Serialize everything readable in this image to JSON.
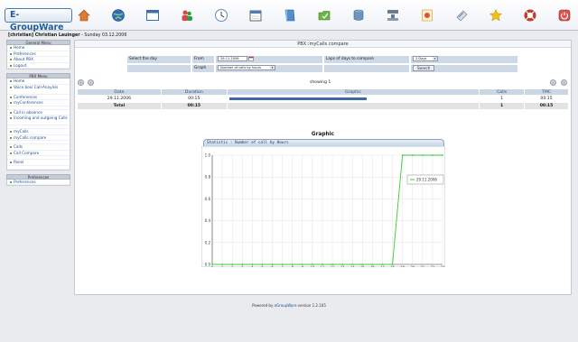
{
  "app": {
    "logo": "E-GroupWare",
    "toolbar_icons": [
      "home-icon",
      "globe-icon",
      "window-icon",
      "users-icon",
      "clock-icon",
      "calendar-icon",
      "book-icon",
      "file-manager-icon",
      "database-icon",
      "network-icon",
      "notes-icon",
      "printer-icon",
      "star-icon",
      "help-icon",
      "logout-icon"
    ]
  },
  "user": {
    "name": "[christian] Christian Lauinger",
    "date": " - Sunday 03.12.2006"
  },
  "sidebar": {
    "general_title": "General Menu",
    "general_items": [
      "Home",
      "Preferences",
      "About PBX",
      "Logout"
    ],
    "pbx_title": "PBX Menu",
    "pbx_groups": [
      [
        "Home",
        "Voice box/ Call-Anaylsis",
        "Conferences",
        "myConferences"
      ],
      [
        "Call in absence",
        "Incoming and outgoing Calls"
      ],
      [
        "myCalls",
        "myCalls compare"
      ],
      [
        "Calls",
        "Call Compare"
      ],
      [
        "Panel"
      ]
    ],
    "prefs_title": "Preferences",
    "prefs_items": [
      "Preferences"
    ]
  },
  "main": {
    "title": "PBX::myCalls compare",
    "form": {
      "select_day_label": "Select the day",
      "from_label": "From",
      "from_value": "29.11.2006",
      "laps_label": "Laps of days to compare",
      "laps_value": "2 Days",
      "graph_label": "Graph",
      "graph_value": "Number of calls by hours",
      "search_button": "Search"
    },
    "showing": "showing 1",
    "table": {
      "headers": [
        "Date",
        "Duration",
        "Graphic",
        "Calls",
        "TMC"
      ],
      "rows": [
        [
          "29.11.2006",
          "00:15",
          "",
          "1",
          "00:15"
        ]
      ],
      "total": [
        "Total",
        "00:15",
        "",
        "1",
        "00:15"
      ],
      "bar_fraction": 0.55
    },
    "graphic_title": "Graphic"
  },
  "chart_data": {
    "type": "line",
    "title": "Statistic : Number of call by Hours",
    "x": [
      0,
      1,
      2,
      3,
      4,
      5,
      6,
      7,
      8,
      9,
      10,
      11,
      12,
      13,
      14,
      15,
      16,
      17,
      18,
      19,
      20,
      21,
      22,
      23
    ],
    "xlim": [
      0,
      23
    ],
    "ylim": [
      0,
      1.0
    ],
    "yticks": [
      "0.0",
      "0.2",
      "0.4",
      "0.6",
      "0.8",
      "1.0"
    ],
    "series": [
      {
        "name": "29.11.2006",
        "color": "#33cc33",
        "values": [
          0,
          0,
          0,
          0,
          0,
          0,
          0,
          0,
          0,
          0,
          0,
          0,
          0,
          0,
          0,
          0,
          0,
          0,
          0,
          1,
          1,
          1,
          1,
          1
        ]
      }
    ],
    "legend": "top-right",
    "grid": true
  },
  "footer": {
    "prefix": "Powered by ",
    "link": "eGroupWare",
    "suffix": " version 1.2.105"
  }
}
